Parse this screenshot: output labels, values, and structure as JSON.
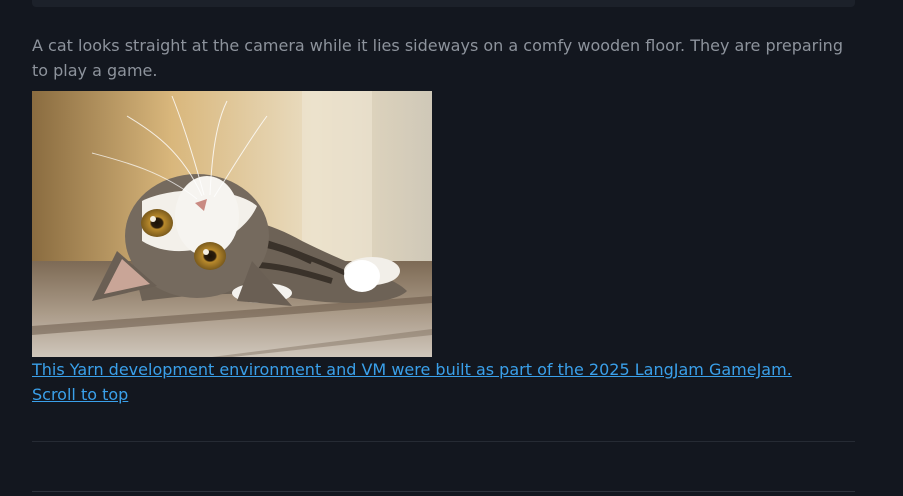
{
  "post": {
    "description": "A cat looks straight at the camera while it lies sideways on a comfy wooden floor. They are preparing to play a game."
  },
  "footer": {
    "credit_link": "This Yarn development environment and VM were built as part of the 2025 LangJam GameJam.",
    "scroll_top_link": "Scroll to top"
  },
  "colors": {
    "background": "#13171f",
    "text_muted": "#8d939c",
    "link": "#3aa0ea"
  }
}
